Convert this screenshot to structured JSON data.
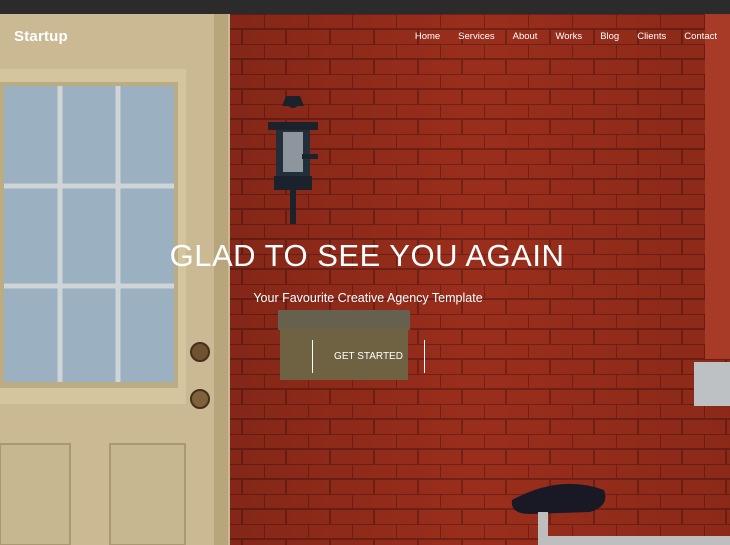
{
  "brand": {
    "name": "Startup"
  },
  "nav": {
    "items": [
      "Home",
      "Services",
      "About",
      "Works",
      "Blog",
      "Clients",
      "Contact"
    ]
  },
  "hero": {
    "headline": "GLAD TO SEE YOU AGAIN",
    "subtitle": "Your Favourite Creative Agency Template",
    "cta_label": "GET STARTED"
  },
  "colors": {
    "brick": "#a8321f",
    "door": "#e6d6ad",
    "window_glass": "#a9c0d3",
    "text": "#ffffff",
    "topbar": "#2b2b2b"
  }
}
